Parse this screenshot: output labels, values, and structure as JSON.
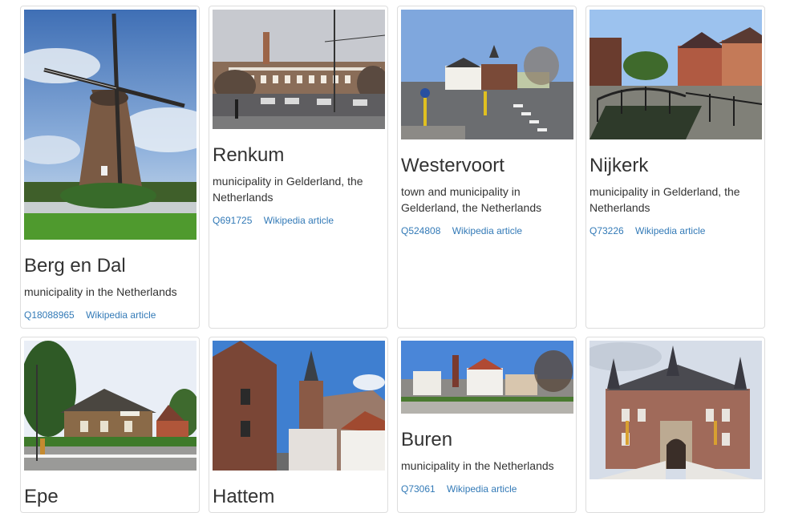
{
  "cards": [
    {
      "title": "Berg en Dal",
      "description": "municipality in the Netherlands",
      "qid": "Q18088965",
      "wiki": "Wikipedia article",
      "image": "windmill-photo"
    },
    {
      "title": "Renkum",
      "description": "municipality in Gelderland, the Netherlands",
      "qid": "Q691725",
      "wiki": "Wikipedia article",
      "image": "town-hall-square-photo"
    },
    {
      "title": "Westervoort",
      "description": "town and municipality in Gelderland, the Netherlands",
      "qid": "Q524808",
      "wiki": "Wikipedia article",
      "image": "street-intersection-photo"
    },
    {
      "title": "Nijkerk",
      "description": "municipality in Gelderland, the Netherlands",
      "qid": "Q73226",
      "wiki": "Wikipedia article",
      "image": "canal-bridge-photo"
    },
    {
      "title": "Epe",
      "image": "brick-house-photo"
    },
    {
      "title": "Hattem",
      "image": "church-street-photo"
    },
    {
      "title": "Buren",
      "description": "municipality in the Netherlands",
      "qid": "Q73061",
      "wiki": "Wikipedia article",
      "image": "village-square-photo"
    },
    {
      "image": "castle-gatehouse-photo"
    }
  ]
}
